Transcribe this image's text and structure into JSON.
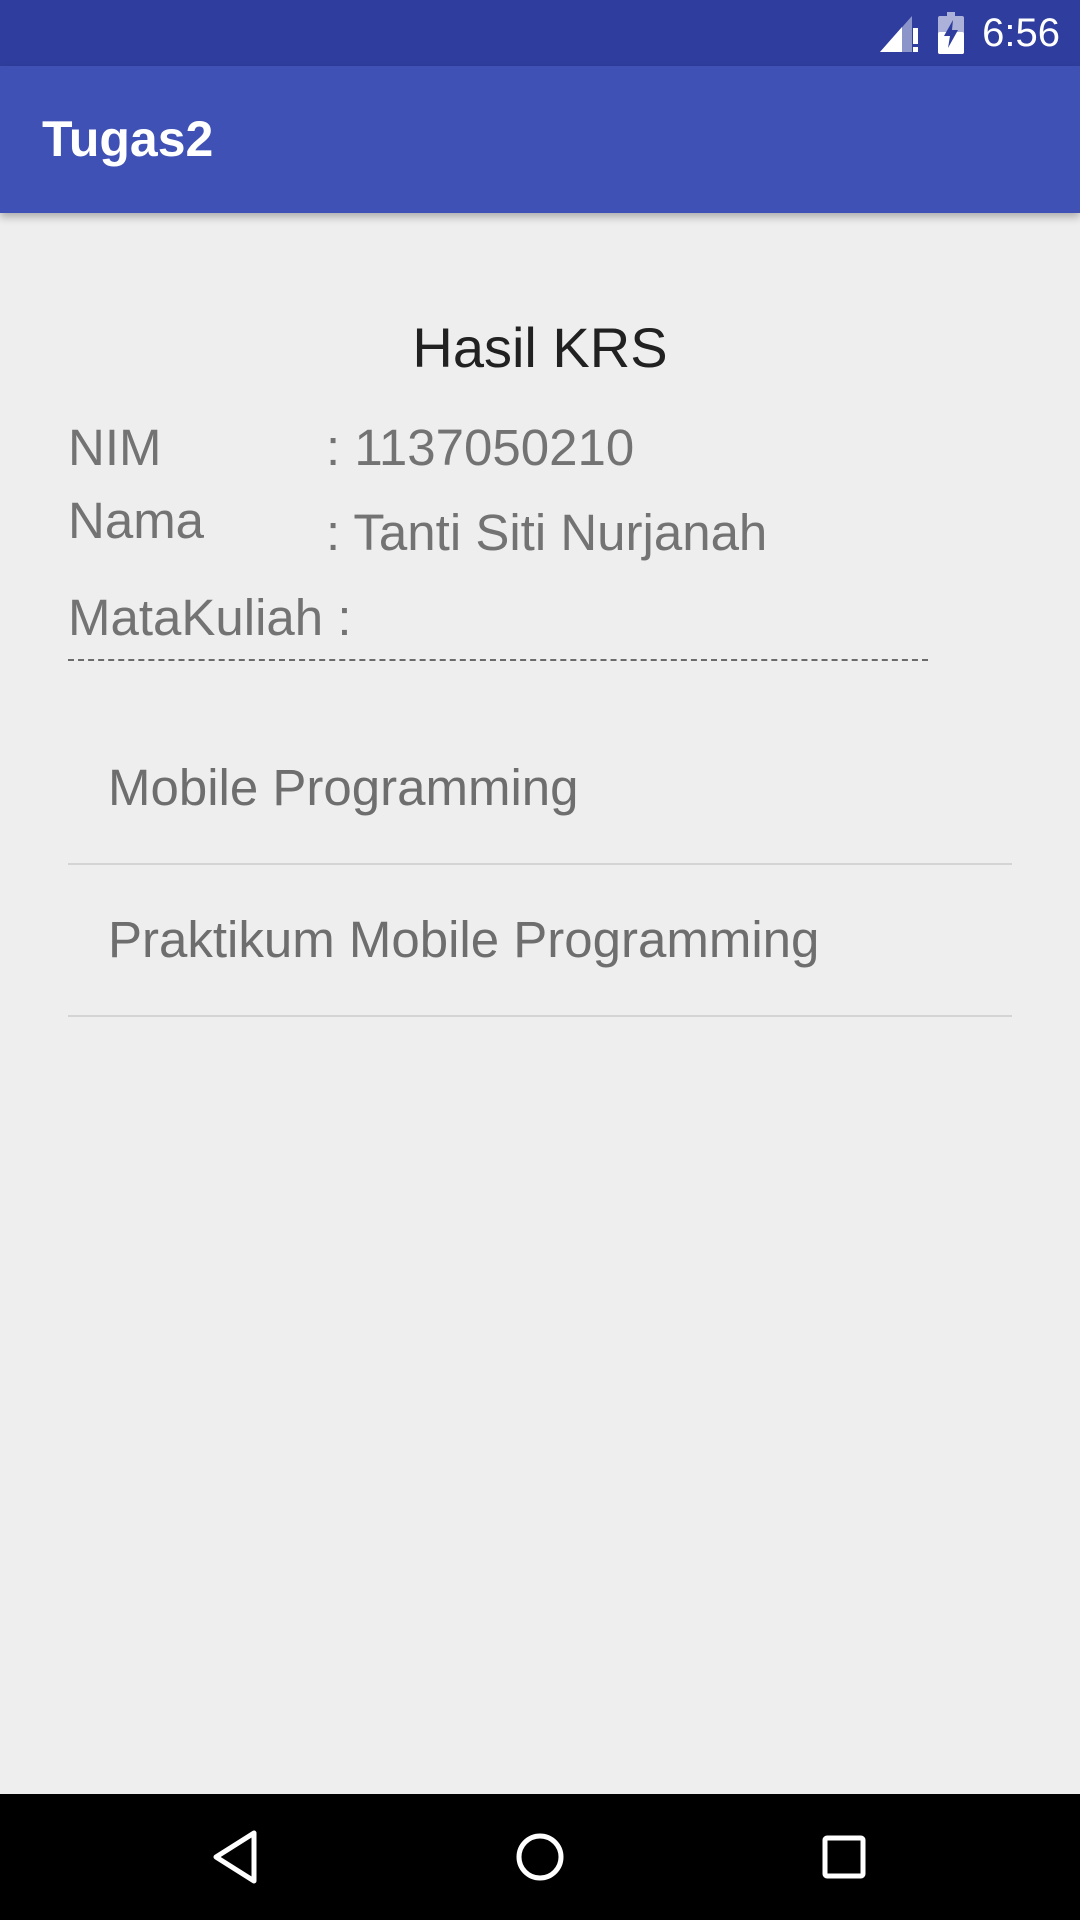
{
  "status_bar": {
    "time": "6:56",
    "icons": [
      "signal-alert-icon",
      "battery-charging-icon"
    ]
  },
  "app_bar": {
    "title": "Tugas2",
    "color": "#3f51b5"
  },
  "result": {
    "heading": "Hasil KRS",
    "nim_label": "NIM",
    "nim_value": ": 1137050210",
    "nama_label": "Nama",
    "nama_value": ": Tanti Siti Nurjanah",
    "matakuliah_label": "MataKuliah :",
    "courses": [
      "Mobile Programming",
      "Praktikum Mobile Programming"
    ]
  },
  "nav_bar": {
    "buttons": [
      "back-icon",
      "home-icon",
      "recents-icon"
    ]
  },
  "colors": {
    "status_bar": "#2f3e9e",
    "primary": "#3f51b5",
    "background": "#eeeeee"
  }
}
